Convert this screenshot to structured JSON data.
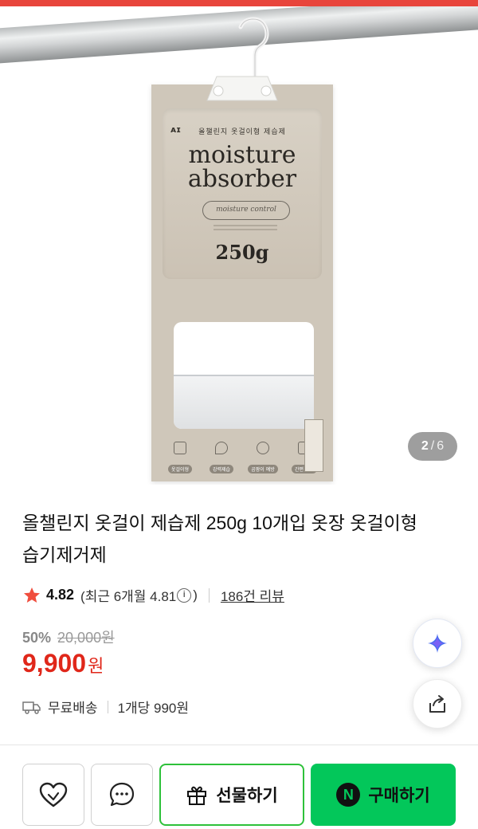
{
  "colors": {
    "accent_red": "#e8453c",
    "price_red": "#e0271a",
    "naver_green": "#03c75a",
    "gift_border": "#2ec13a",
    "bag_beige": "#cfc7ba"
  },
  "image": {
    "bag_brand_mark": "ᴀɪ",
    "bag_korean_title": "올챌린지 옷걸이형 제습제",
    "bag_title_line1": "moisture",
    "bag_title_line2": "absorber",
    "bag_pill_text": "moisture control",
    "bag_weight": "250g",
    "bag_icons": [
      {
        "label": "옷걸이형",
        "icon": "hanger-icon"
      },
      {
        "label": "강력제습",
        "icon": "drop-icon"
      },
      {
        "label": "곰팡이 예방",
        "icon": "sparkle-icon"
      },
      {
        "label": "간편 폐기",
        "icon": "trash-icon"
      }
    ],
    "counter": {
      "current": "2",
      "separator": "/",
      "total": "6"
    }
  },
  "product": {
    "title": "올챌린지 옷걸이 제습제 250g 10개입 옷장 옷걸이형 습기제거제",
    "rating": {
      "score": "4.82",
      "recent_prefix": "(최근 6개월 4.81",
      "recent_suffix": ")",
      "review_link": "186건 리뷰"
    },
    "price": {
      "discount_rate": "50%",
      "original": "20,000원",
      "sale": "9,900",
      "sale_unit": "원"
    },
    "shipping": {
      "free_label": "무료배송",
      "unit_price": "1개당 990원"
    }
  },
  "bottom_bar": {
    "gift_label": "선물하기",
    "buy_label": "구매하기",
    "npay_letter": "N"
  }
}
